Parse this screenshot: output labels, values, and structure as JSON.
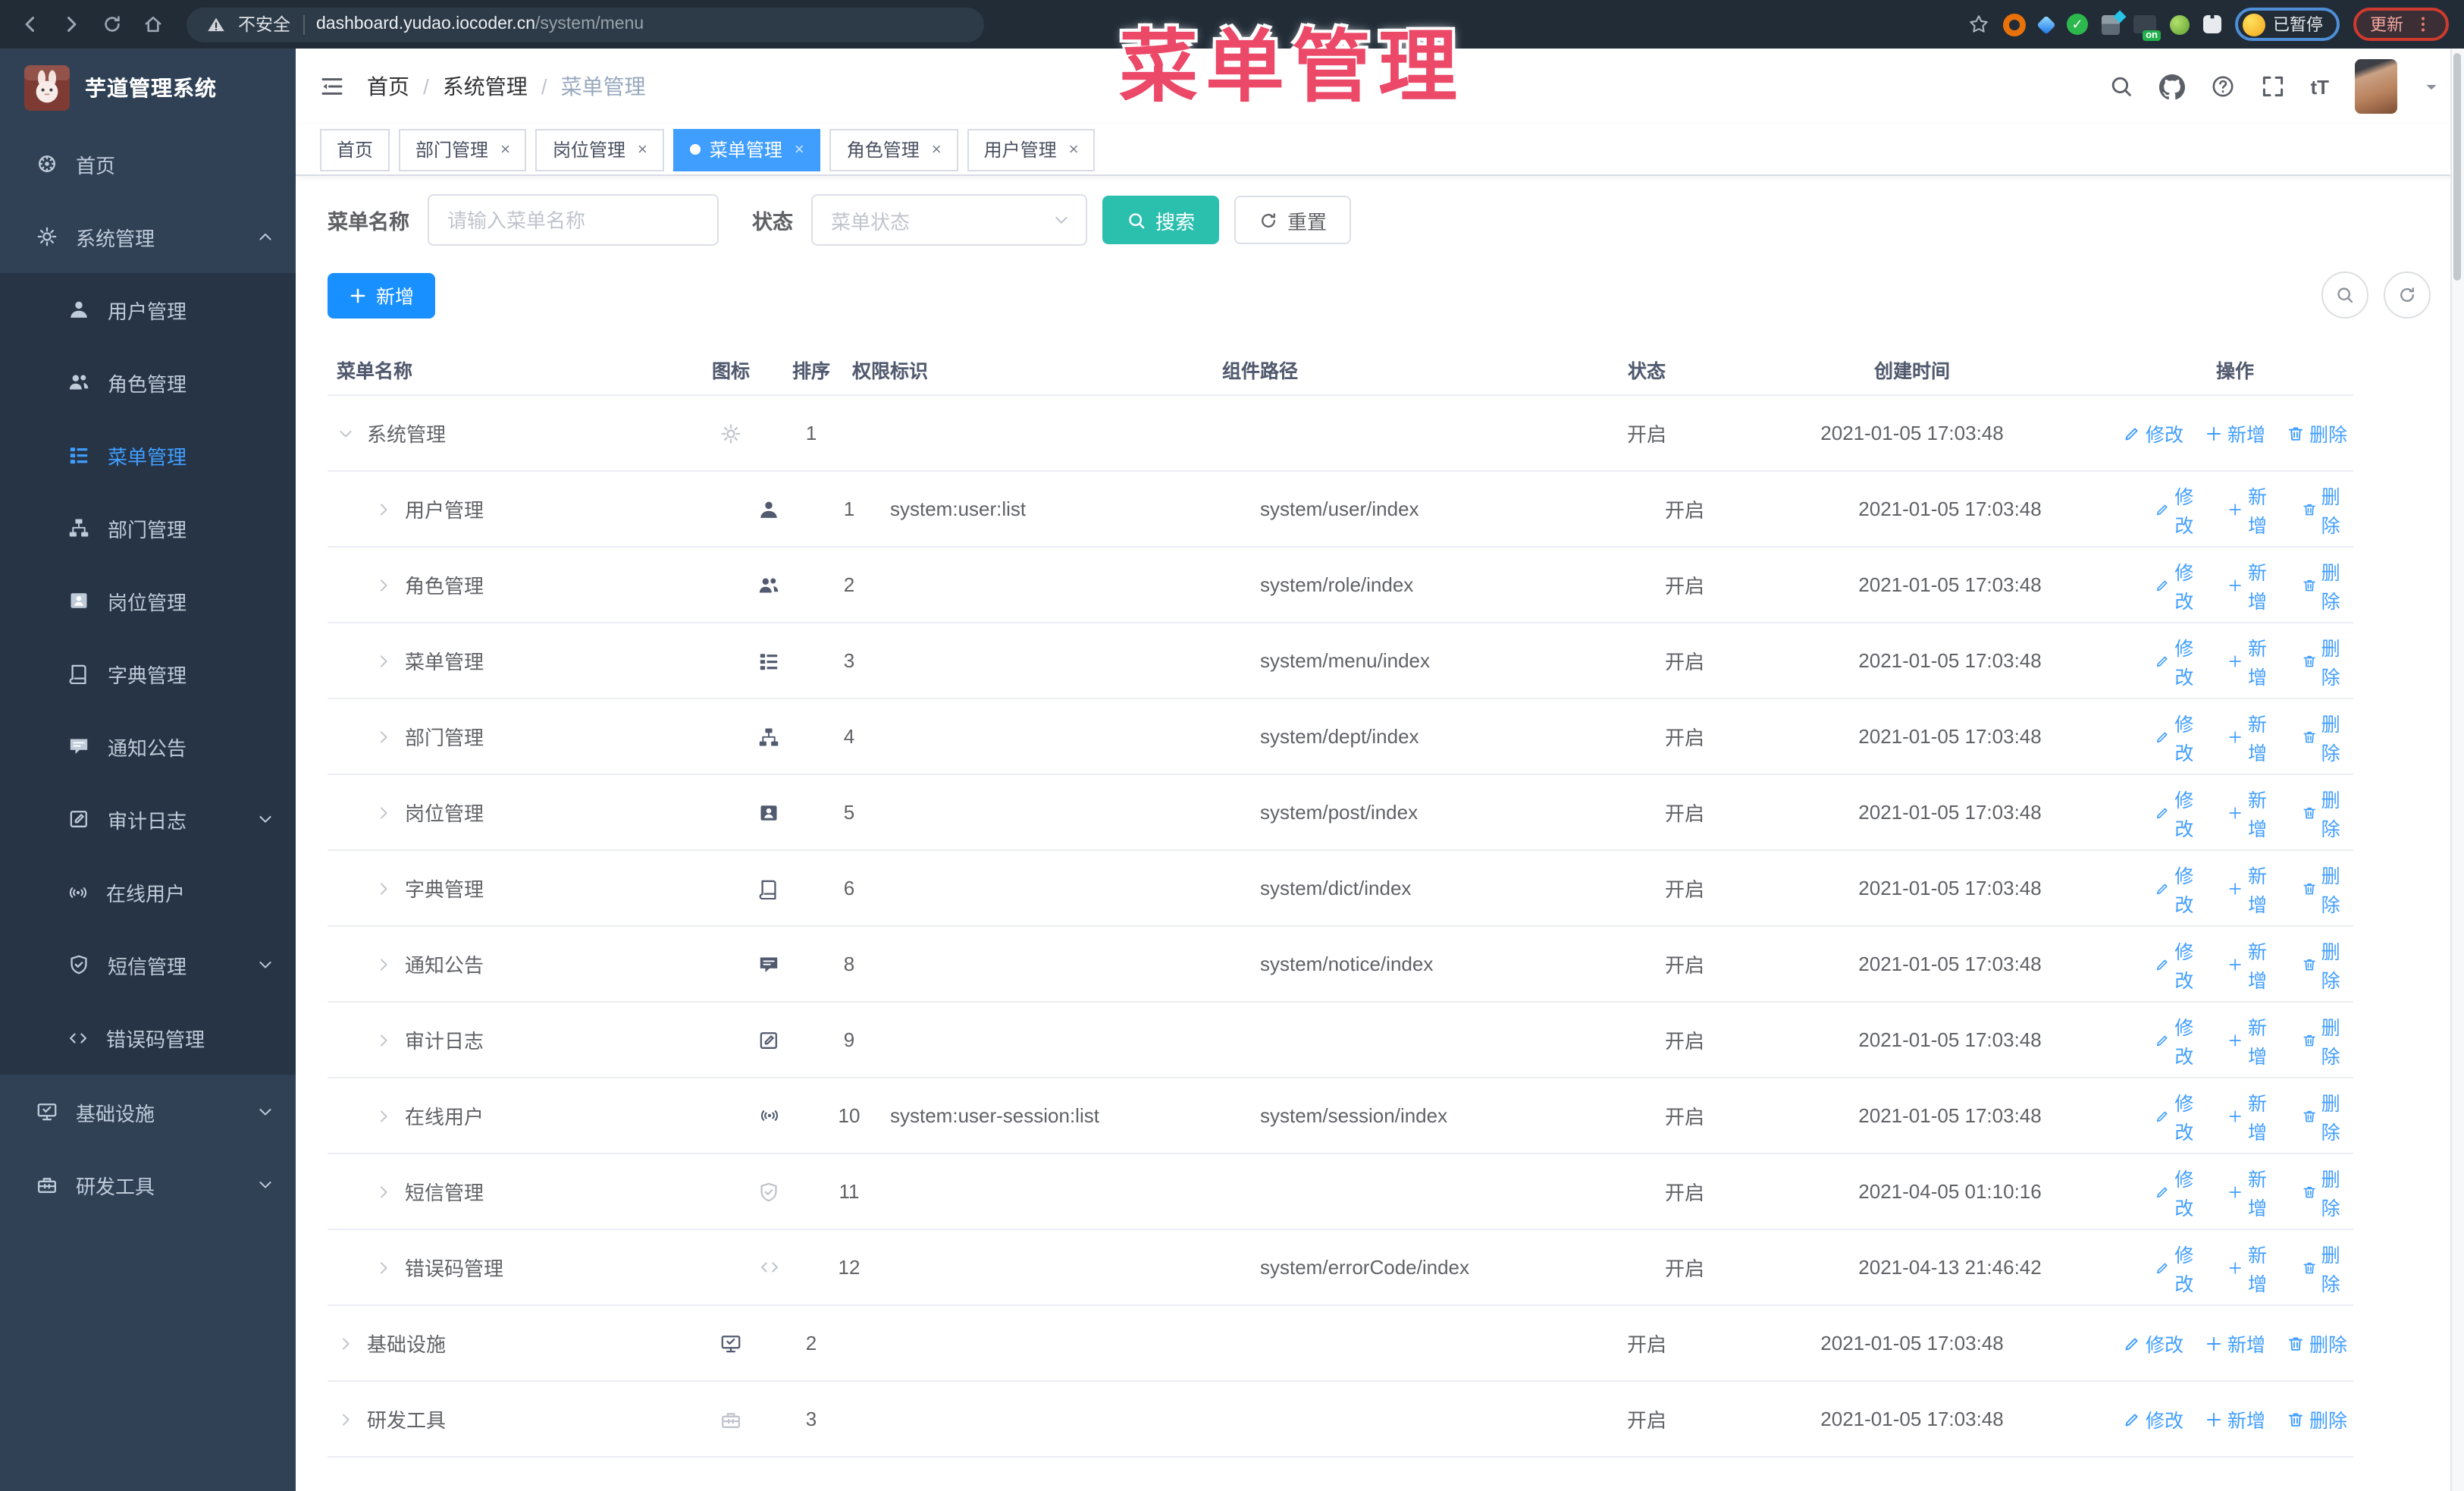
{
  "browser": {
    "security_label": "不安全",
    "url_domain": "dashboard.yudao.iocoder.cn",
    "url_path": "/system/menu",
    "paused_label": "已暂停",
    "update_label": "更新",
    "on_badge": "on"
  },
  "overlay_title": "菜单管理",
  "sidebar": {
    "app_title": "芋道管理系统",
    "items": [
      {
        "label": "首页",
        "icon": "home",
        "level": 0
      },
      {
        "label": "系统管理",
        "icon": "gear",
        "level": 0,
        "arrow": "up"
      },
      {
        "label": "用户管理",
        "icon": "user",
        "level": 1
      },
      {
        "label": "角色管理",
        "icon": "users",
        "level": 1
      },
      {
        "label": "菜单管理",
        "icon": "menu",
        "level": 1,
        "active": true
      },
      {
        "label": "部门管理",
        "icon": "tree",
        "level": 1
      },
      {
        "label": "岗位管理",
        "icon": "post",
        "level": 1
      },
      {
        "label": "字典管理",
        "icon": "dict",
        "level": 1
      },
      {
        "label": "通知公告",
        "icon": "message",
        "level": 1
      },
      {
        "label": "审计日志",
        "icon": "log",
        "level": 1,
        "arrow": "down"
      },
      {
        "label": "在线用户",
        "icon": "online",
        "level": 1
      },
      {
        "label": "短信管理",
        "icon": "sms",
        "level": 1,
        "arrow": "down"
      },
      {
        "label": "错误码管理",
        "icon": "code",
        "level": 1
      },
      {
        "label": "基础设施",
        "icon": "monitor",
        "level": 0,
        "arrow": "down"
      },
      {
        "label": "研发工具",
        "icon": "toolbox",
        "level": 0,
        "arrow": "down"
      }
    ]
  },
  "topbar": {
    "breadcrumb": [
      "首页",
      "系统管理",
      "菜单管理"
    ]
  },
  "tabs": [
    {
      "label": "首页",
      "closable": false,
      "active": false
    },
    {
      "label": "部门管理",
      "closable": true,
      "active": false
    },
    {
      "label": "岗位管理",
      "closable": true,
      "active": false
    },
    {
      "label": "菜单管理",
      "closable": true,
      "active": true
    },
    {
      "label": "角色管理",
      "closable": true,
      "active": false
    },
    {
      "label": "用户管理",
      "closable": true,
      "active": false
    }
  ],
  "filters": {
    "name_label": "菜单名称",
    "name_placeholder": "请输入菜单名称",
    "name_value": "",
    "status_label": "状态",
    "status_placeholder": "菜单状态",
    "search_label": "搜索",
    "reset_label": "重置"
  },
  "toolbar": {
    "add_label": "新增"
  },
  "table": {
    "columns": [
      "菜单名称",
      "图标",
      "排序",
      "权限标识",
      "组件路径",
      "状态",
      "创建时间",
      "操作"
    ],
    "actions": [
      "修改",
      "新增",
      "删除"
    ],
    "rows": [
      {
        "name": "系统管理",
        "level": 0,
        "expanded": true,
        "icon": "gear",
        "icon_light": true,
        "sort": "1",
        "perm": "",
        "path": "",
        "status": "开启",
        "time": "2021-01-05 17:03:48"
      },
      {
        "name": "用户管理",
        "level": 1,
        "expanded": false,
        "icon": "user",
        "icon_light": false,
        "sort": "1",
        "perm": "system:user:list",
        "path": "system/user/index",
        "status": "开启",
        "time": "2021-01-05 17:03:48"
      },
      {
        "name": "角色管理",
        "level": 1,
        "expanded": false,
        "icon": "users",
        "icon_light": false,
        "sort": "2",
        "perm": "",
        "path": "system/role/index",
        "status": "开启",
        "time": "2021-01-05 17:03:48"
      },
      {
        "name": "菜单管理",
        "level": 1,
        "expanded": false,
        "icon": "menu",
        "icon_light": false,
        "sort": "3",
        "perm": "",
        "path": "system/menu/index",
        "status": "开启",
        "time": "2021-01-05 17:03:48"
      },
      {
        "name": "部门管理",
        "level": 1,
        "expanded": false,
        "icon": "tree",
        "icon_light": false,
        "sort": "4",
        "perm": "",
        "path": "system/dept/index",
        "status": "开启",
        "time": "2021-01-05 17:03:48"
      },
      {
        "name": "岗位管理",
        "level": 1,
        "expanded": false,
        "icon": "post",
        "icon_light": false,
        "sort": "5",
        "perm": "",
        "path": "system/post/index",
        "status": "开启",
        "time": "2021-01-05 17:03:48"
      },
      {
        "name": "字典管理",
        "level": 1,
        "expanded": false,
        "icon": "dict",
        "icon_light": false,
        "sort": "6",
        "perm": "",
        "path": "system/dict/index",
        "status": "开启",
        "time": "2021-01-05 17:03:48"
      },
      {
        "name": "通知公告",
        "level": 1,
        "expanded": false,
        "icon": "message",
        "icon_light": false,
        "sort": "8",
        "perm": "",
        "path": "system/notice/index",
        "status": "开启",
        "time": "2021-01-05 17:03:48"
      },
      {
        "name": "审计日志",
        "level": 1,
        "expanded": false,
        "icon": "log",
        "icon_light": false,
        "sort": "9",
        "perm": "",
        "path": "",
        "status": "开启",
        "time": "2021-01-05 17:03:48"
      },
      {
        "name": "在线用户",
        "level": 1,
        "expanded": false,
        "icon": "online",
        "icon_light": false,
        "sort": "10",
        "perm": "system:user-session:list",
        "path": "system/session/index",
        "status": "开启",
        "time": "2021-01-05 17:03:48"
      },
      {
        "name": "短信管理",
        "level": 1,
        "expanded": false,
        "icon": "sms",
        "icon_light": true,
        "sort": "11",
        "perm": "",
        "path": "",
        "status": "开启",
        "time": "2021-04-05 01:10:16"
      },
      {
        "name": "错误码管理",
        "level": 1,
        "expanded": false,
        "icon": "code",
        "icon_light": true,
        "sort": "12",
        "perm": "",
        "path": "system/errorCode/index",
        "status": "开启",
        "time": "2021-04-13 21:46:42"
      },
      {
        "name": "基础设施",
        "level": 0,
        "expanded": false,
        "icon": "monitor",
        "icon_light": false,
        "sort": "2",
        "perm": "",
        "path": "",
        "status": "开启",
        "time": "2021-01-05 17:03:48"
      },
      {
        "name": "研发工具",
        "level": 0,
        "expanded": false,
        "icon": "toolbox",
        "icon_light": true,
        "sort": "3",
        "perm": "",
        "path": "",
        "status": "开启",
        "time": "2021-01-05 17:03:48"
      }
    ]
  },
  "colors": {
    "accent_blue": "#409eff",
    "primary_button": "#1890ff",
    "search_teal": "#2bbfae",
    "sidebar_bg": "#304156",
    "submenu_bg": "#263445",
    "overlay_pink": "#ec4868",
    "browser_bar": "#212c37"
  }
}
